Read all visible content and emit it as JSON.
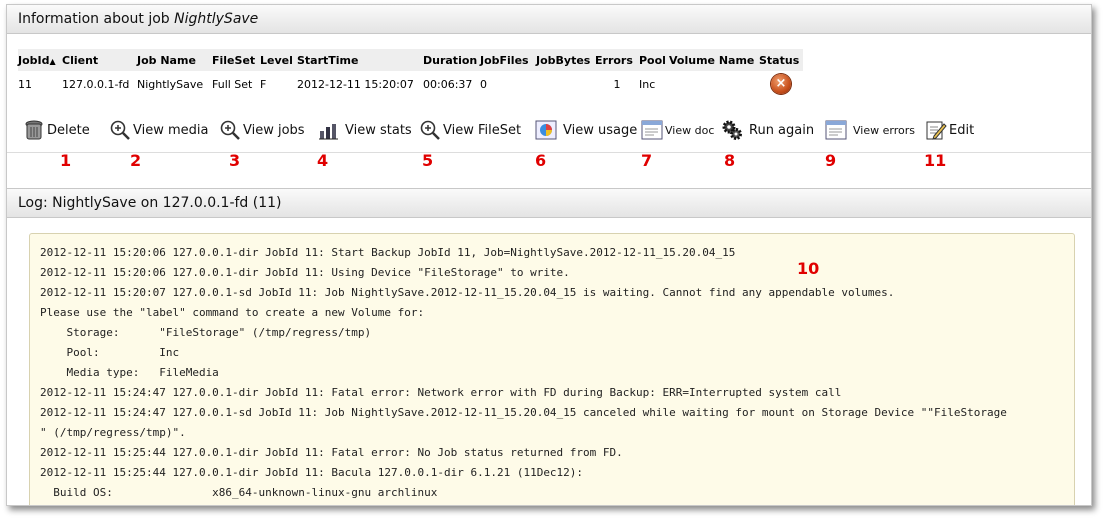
{
  "job_header": {
    "prefix": "Information about job ",
    "job_name": "NightlySave"
  },
  "table": {
    "columns": [
      "JobId",
      "Client",
      "Job Name",
      "FileSet",
      "Level",
      "StartTime",
      "Duration",
      "JobFiles",
      "JobBytes",
      "Errors",
      "Pool",
      "Volume Name",
      "Status"
    ],
    "sort_indicator": "▲",
    "row": {
      "jobid": "11",
      "client": "127.0.0.1-fd",
      "job_name": "NightlySave",
      "fileset": "Full Set",
      "level": "F",
      "starttime": "2012-12-11 15:20:07",
      "duration": "00:06:37",
      "jobfiles": "0",
      "jobbytes": "",
      "errors": "1",
      "pool": "Inc",
      "volume_name": "",
      "status_icon": "error-icon",
      "status_glyph": "×"
    }
  },
  "toolbar": [
    {
      "label": "Delete",
      "icon": "trash-icon",
      "num": "1"
    },
    {
      "label": "View media",
      "icon": "zoom-icon",
      "num": "2"
    },
    {
      "label": "View jobs",
      "icon": "zoom-icon",
      "num": "3"
    },
    {
      "label": "View stats",
      "icon": "chart-icon",
      "num": "4"
    },
    {
      "label": "View FileSet",
      "icon": "zoom-icon",
      "num": "5"
    },
    {
      "label": "View usage",
      "icon": "pie-icon",
      "num": "6"
    },
    {
      "label": "View doc",
      "icon": "doc-icon",
      "num": "7"
    },
    {
      "label": "Run again",
      "icon": "gears-icon",
      "num": "8"
    },
    {
      "label": "View errors",
      "icon": "doc-icon",
      "num": "9"
    },
    {
      "label": "Edit",
      "icon": "edit-icon",
      "num": "11"
    }
  ],
  "log_header": "Log: NightlySave on 127.0.0.1-fd (11)",
  "log_marker": "10",
  "log": [
    "2012-12-11 15:20:06 127.0.0.1-dir JobId 11: Start Backup JobId 11, Job=NightlySave.2012-12-11_15.20.04_15",
    "2012-12-11 15:20:06 127.0.0.1-dir JobId 11: Using Device \"FileStorage\" to write.",
    "2012-12-11 15:20:07 127.0.0.1-sd JobId 11: Job NightlySave.2012-12-11_15.20.04_15 is waiting. Cannot find any appendable volumes.",
    "Please use the \"label\" command to create a new Volume for:",
    "    Storage:      \"FileStorage\" (/tmp/regress/tmp)",
    "    Pool:         Inc",
    "    Media type:   FileMedia",
    "2012-12-11 15:24:47 127.0.0.1-dir JobId 11: Fatal error: Network error with FD during Backup: ERR=Interrupted system call",
    "2012-12-11 15:24:47 127.0.0.1-sd JobId 11: Job NightlySave.2012-12-11_15.20.04_15 canceled while waiting for mount on Storage Device \"\"FileStorage",
    "\" (/tmp/regress/tmp)\".",
    "2012-12-11 15:25:44 127.0.0.1-dir JobId 11: Fatal error: No Job status returned from FD.",
    "2012-12-11 15:25:44 127.0.0.1-dir JobId 11: Bacula 127.0.0.1-dir 6.1.21 (11Dec12):",
    "  Build OS:               x86_64-unknown-linux-gnu archlinux"
  ]
}
